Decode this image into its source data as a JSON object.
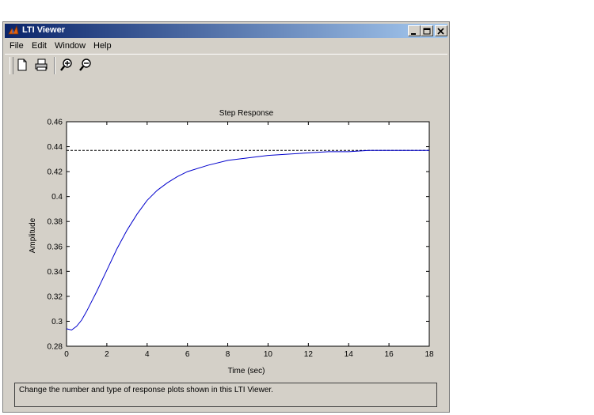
{
  "window": {
    "title": "LTI Viewer"
  },
  "menu": [
    "File",
    "Edit",
    "Window",
    "Help"
  ],
  "toolbar": {
    "icons": [
      "new-file-icon",
      "print-icon",
      "zoom-in-icon",
      "zoom-out-icon"
    ]
  },
  "colors": {
    "titlebar_start": "#0a246a",
    "titlebar_end": "#a6caf0",
    "response_line": "#0000cc"
  },
  "chart_data": {
    "type": "line",
    "title": "Step Response",
    "xlabel": "Time (sec)",
    "ylabel": "Amplitude",
    "xlim": [
      0,
      18
    ],
    "ylim": [
      0.28,
      0.46
    ],
    "xticks": [
      "0",
      "2",
      "4",
      "6",
      "8",
      "10",
      "12",
      "14",
      "16",
      "18"
    ],
    "yticks": [
      "0.28",
      "0.3",
      "0.32",
      "0.34",
      "0.36",
      "0.38",
      "0.4",
      "0.42",
      "0.44",
      "0.46"
    ],
    "grid": false,
    "steady_state": 0.437,
    "series": [
      {
        "x": [
          0,
          0.25,
          0.5,
          0.75,
          1,
          1.25,
          1.5,
          2,
          2.5,
          3,
          3.5,
          4,
          4.5,
          5,
          5.5,
          6,
          7,
          8,
          9,
          10,
          11,
          12,
          13,
          14,
          15,
          16,
          17,
          18
        ],
        "y": [
          0.294,
          0.293,
          0.296,
          0.301,
          0.308,
          0.316,
          0.324,
          0.341,
          0.358,
          0.373,
          0.386,
          0.397,
          0.405,
          0.411,
          0.416,
          0.42,
          0.425,
          0.429,
          0.431,
          0.433,
          0.434,
          0.435,
          0.436,
          0.436,
          0.437,
          0.437,
          0.437,
          0.437
        ]
      }
    ]
  },
  "status": {
    "text": "Change the number and type of response plots shown in this LTI Viewer."
  }
}
